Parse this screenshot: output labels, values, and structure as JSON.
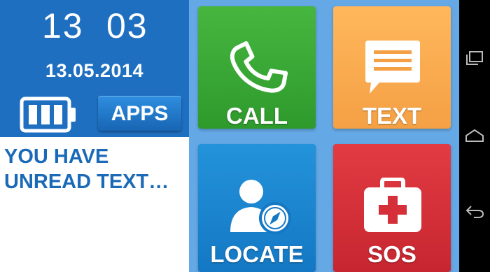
{
  "clock": {
    "hours": "13",
    "minutes": "03",
    "date": "13.05.2014"
  },
  "battery": {
    "icon": "battery-icon",
    "level": 3
  },
  "apps": {
    "label": "APPS"
  },
  "notice": {
    "text": "YOU HAVE UNREAD TEXT…"
  },
  "tiles": {
    "call": {
      "label": "CALL",
      "icon": "phone-icon",
      "color": "#3aa935"
    },
    "text": {
      "label": "TEXT",
      "icon": "message-icon",
      "color": "#fbaa4e"
    },
    "locate": {
      "label": "LOCATE",
      "icon": "locate-icon",
      "color": "#1b86d0"
    },
    "sos": {
      "label": "SOS",
      "icon": "first-aid-icon",
      "color": "#d5303a"
    }
  },
  "navbar": {
    "icons": [
      "recent-apps-icon",
      "home-icon",
      "back-icon"
    ]
  },
  "colors": {
    "header_blue": "#1f6fc1",
    "tile_background": "#65a8e6",
    "notice_text": "#1b6ab8"
  }
}
